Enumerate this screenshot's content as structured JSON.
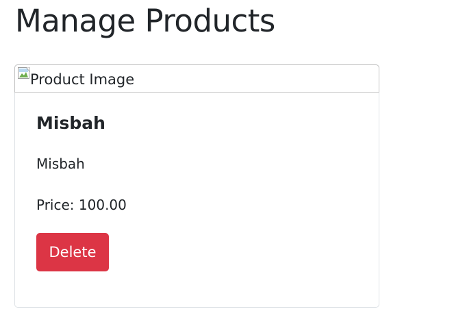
{
  "page": {
    "title": "Manage Products"
  },
  "product_card": {
    "image_alt": "Product Image",
    "image_icon": "broken-image-icon",
    "name": "Misbah",
    "description": "Misbah",
    "price_label": "Price:",
    "price_value": "100.00",
    "delete_label": "Delete"
  },
  "colors": {
    "danger": "#dc3545",
    "text": "#212529",
    "border": "#dee2e6"
  }
}
